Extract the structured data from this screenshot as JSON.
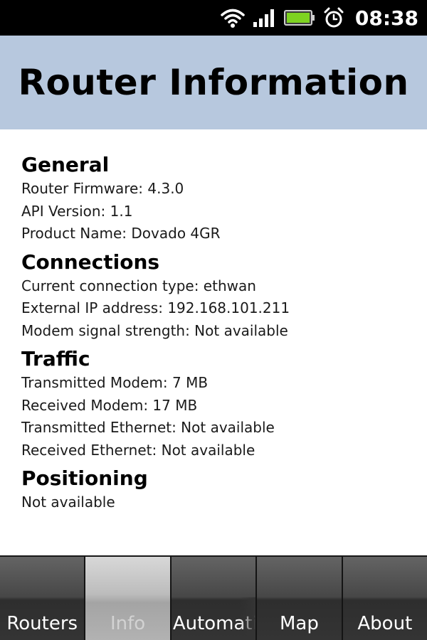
{
  "status_bar": {
    "time": "08:38",
    "icons": [
      "wifi-icon",
      "signal-icon",
      "battery-icon",
      "alarm-icon"
    ],
    "colors": {
      "background": "#000000",
      "battery": "#7ed321"
    }
  },
  "header": {
    "title": "Router Information",
    "background": "#b7c8de"
  },
  "sections": [
    {
      "title": "General",
      "lines": [
        "Router Firmware: 4.3.0",
        "API Version: 1.1",
        "Product Name: Dovado 4GR"
      ]
    },
    {
      "title": "Connections",
      "lines": [
        "Current connection type: ethwan",
        "External IP address: 192.168.101.211",
        "Modem signal strength: Not available"
      ]
    },
    {
      "title": "Traffic",
      "lines": [
        "Transmitted Modem: 7 MB",
        "Received Modem: 17 MB",
        "Transmitted Ethernet: Not available",
        "Received Ethernet: Not available"
      ]
    },
    {
      "title": "Positioning",
      "lines": [
        "Not available"
      ]
    }
  ],
  "tabs": [
    {
      "label": "Routers",
      "selected": false
    },
    {
      "label": "Info",
      "selected": true
    },
    {
      "label": "Automatic",
      "selected": false
    },
    {
      "label": "Map",
      "selected": false
    },
    {
      "label": "About",
      "selected": false
    }
  ]
}
